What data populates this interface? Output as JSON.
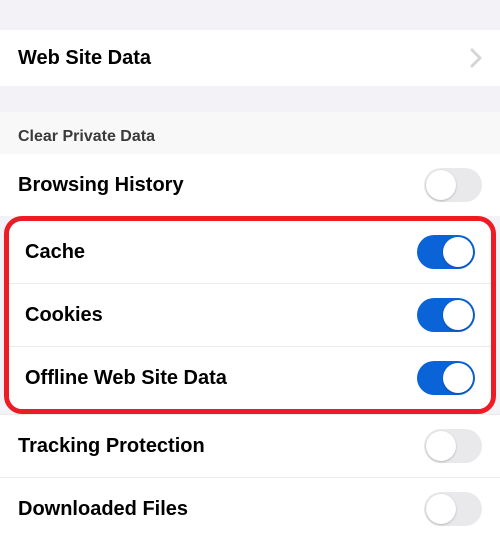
{
  "nav": {
    "web_site_data_label": "Web Site Data"
  },
  "clear_private_data_header": "Clear Private Data",
  "items": {
    "browsing_history": {
      "label": "Browsing History",
      "on": false
    },
    "cache": {
      "label": "Cache",
      "on": true
    },
    "cookies": {
      "label": "Cookies",
      "on": true
    },
    "offline_web_site_data": {
      "label": "Offline Web Site Data",
      "on": true
    },
    "tracking_protection": {
      "label": "Tracking Protection",
      "on": false
    },
    "downloaded_files": {
      "label": "Downloaded Files",
      "on": false
    }
  }
}
